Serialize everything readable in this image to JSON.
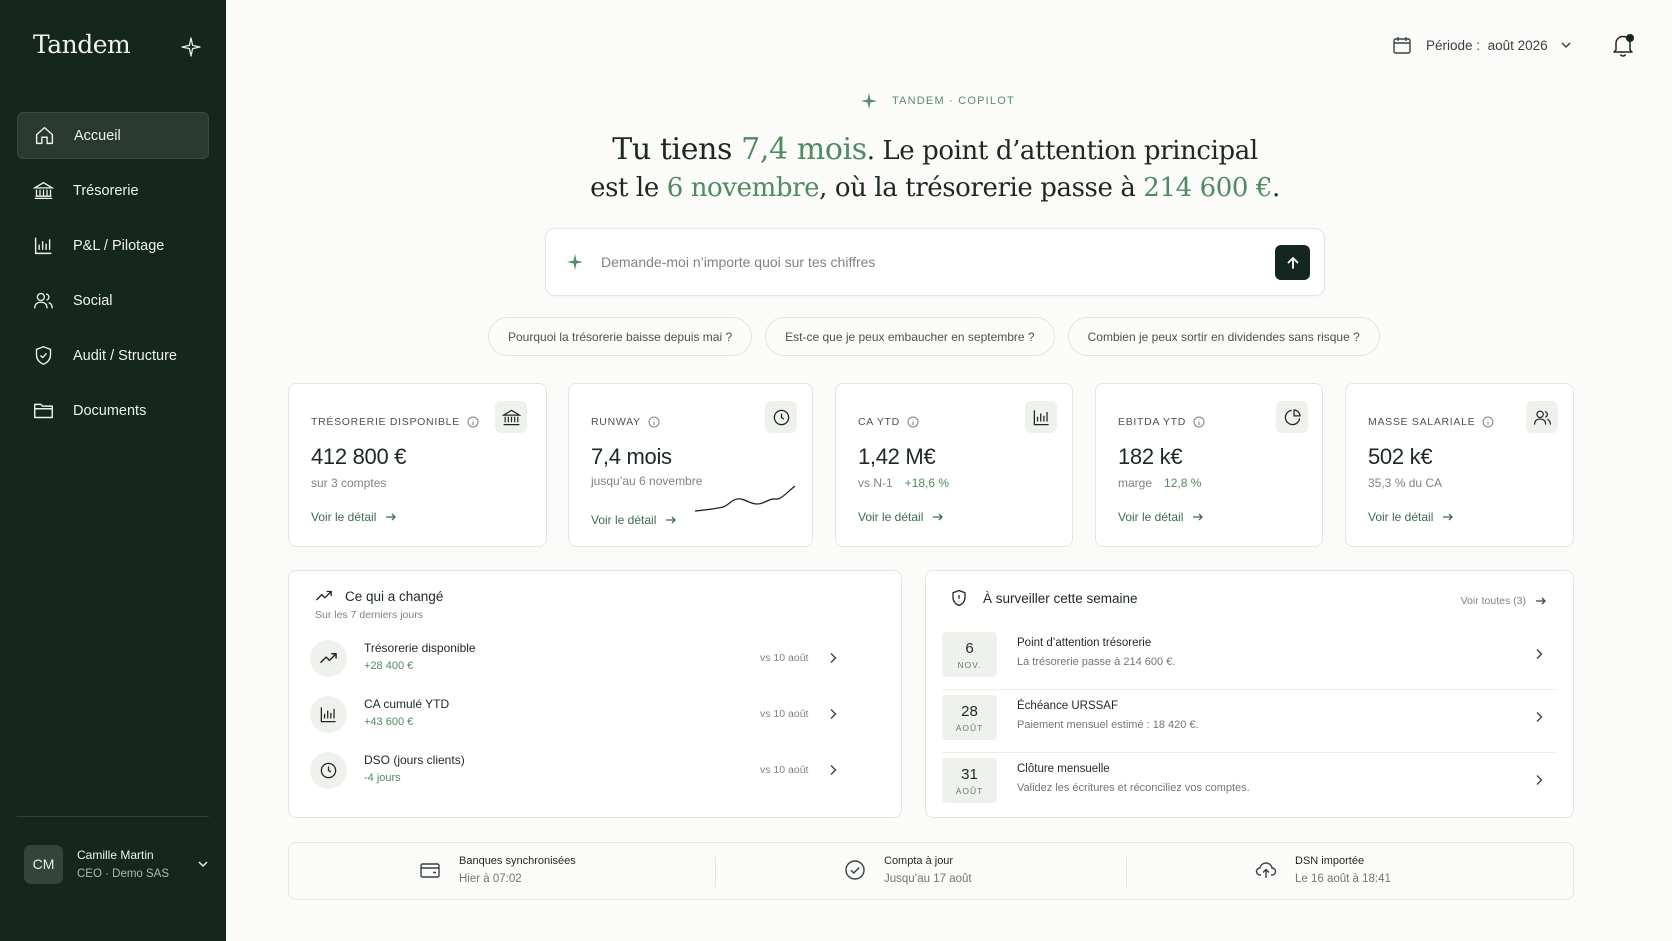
{
  "app": {
    "brand": "Tandem"
  },
  "sidebar": {
    "items": [
      {
        "label": "Accueil",
        "icon": "home-icon"
      },
      {
        "label": "Trésorerie",
        "icon": "bank-icon"
      },
      {
        "label": "P&L / Pilotage",
        "icon": "bar-chart-icon"
      },
      {
        "label": "Social",
        "icon": "users-icon"
      },
      {
        "label": "Audit / Structure",
        "icon": "shield-icon"
      },
      {
        "label": "Documents",
        "icon": "folder-icon"
      }
    ],
    "active": "Accueil",
    "user": {
      "initials": "CM",
      "name": "Camille Martin",
      "role": "CEO · Demo SAS"
    }
  },
  "topbar": {
    "period_label": "Période :",
    "period_value": "août 2026"
  },
  "hero": {
    "eyebrow": "TANDEM · COPILOT",
    "l1_a": "Tu tiens ",
    "l1_runway": "7,4 mois",
    "l1_b": ". Le point d’attention principal",
    "l2_a": "est le ",
    "l2_date": "6 novembre",
    "l2_b": ", où la trésorerie passe à ",
    "l2_amount": "214 600 €",
    "l2_c": "."
  },
  "ask": {
    "placeholder": "Demande-moi n’importe quoi sur tes chiffres"
  },
  "suggestions": [
    "Pourquoi la trésorerie baisse depuis mai ?",
    "Est-ce que je peux embaucher en septembre ?",
    "Combien je peux sortir en dividendes sans risque ?"
  ],
  "kpis": {
    "link": "Voir le détail",
    "treasury": {
      "label": "TRÉSORERIE DISPONIBLE",
      "value": "412 800 €",
      "sub": "sur 3 comptes"
    },
    "runway": {
      "label": "RUNWAY",
      "value": "7,4 mois",
      "sub": "jusqu’au 6 novembre"
    },
    "ca": {
      "label": "CA YTD",
      "value": "1,42 M€",
      "sub": "vs N-1",
      "delta": "+18,6 %"
    },
    "ebitda": {
      "label": "EBITDA YTD",
      "value": "182 k€",
      "sub": "marge",
      "delta": "12,8 %"
    },
    "payroll": {
      "label": "MASSE SALARIALE",
      "value": "502 k€",
      "sub": "35,3 % du CA"
    }
  },
  "changes": {
    "title": "Ce qui a changé",
    "subtitle": "Sur les 7 derniers jours",
    "rows": [
      {
        "name": "Trésorerie disponible",
        "delta": "+28 400 €",
        "vs": "vs 10 août"
      },
      {
        "name": "CA cumulé YTD",
        "delta": "+43 600 €",
        "vs": "vs 10 août"
      },
      {
        "name": "DSO (jours clients)",
        "delta": "-4 jours",
        "vs": "vs 10 août"
      }
    ]
  },
  "watch": {
    "title": "À surveiller cette semaine",
    "see_all": "Voir toutes (3)",
    "rows": [
      {
        "day": "6",
        "month": "NOV.",
        "title": "Point d’attention trésorerie",
        "desc": "La trésorerie passe à 214 600 €."
      },
      {
        "day": "28",
        "month": "AOÛT",
        "title": "Échéance URSSAF",
        "desc": "Paiement mensuel estimé : 18 420 €."
      },
      {
        "day": "31",
        "month": "AOÛT",
        "title": "Clôture mensuelle",
        "desc": "Validez les écritures et réconciliez vos comptes."
      }
    ]
  },
  "status": [
    {
      "title": "Banques synchronisées",
      "sub": "Hier à 07:02"
    },
    {
      "title": "Compta à jour",
      "sub": "Jusqu’au 17 août"
    },
    {
      "title": "DSN importée",
      "sub": "Le 16 août à 18:41"
    }
  ],
  "colors": {
    "sidebar": "#14261e",
    "accent": "#4f8a62",
    "background": "#fbfbf9"
  }
}
